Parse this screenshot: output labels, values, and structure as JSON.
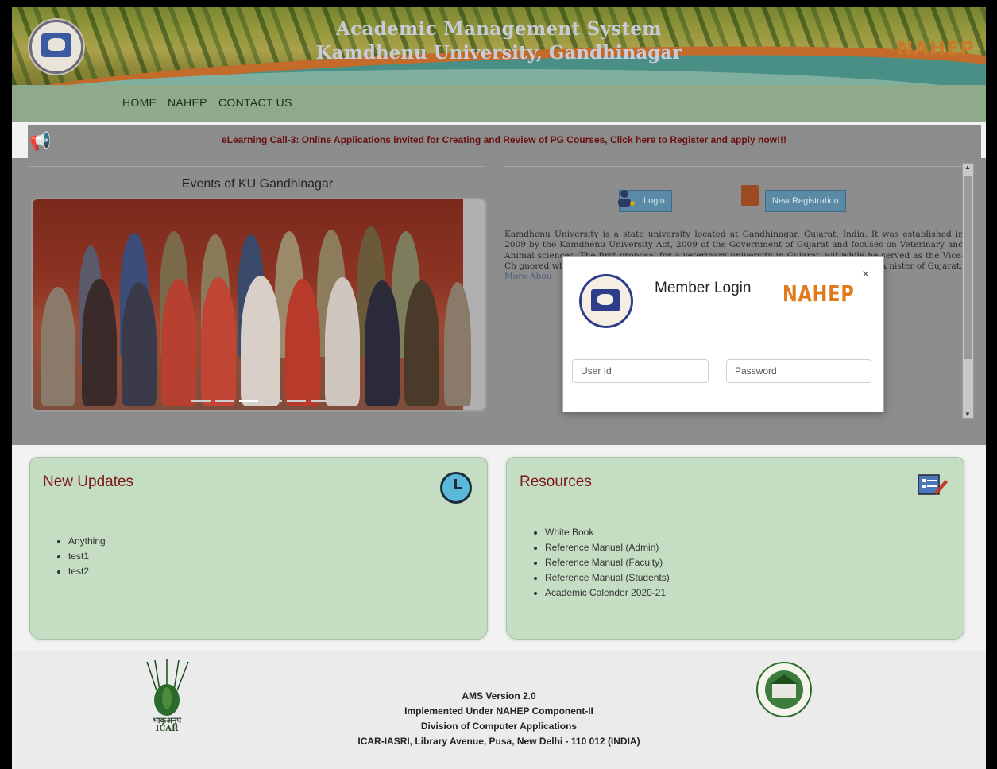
{
  "header": {
    "title_line1": "Academic Management System",
    "title_line2": "Kamdhenu University, Gandhinagar",
    "right_logo_text": "NAHEP"
  },
  "nav": {
    "items": [
      {
        "label": "HOME"
      },
      {
        "label": "NAHEP"
      },
      {
        "label": "CONTACT US"
      }
    ]
  },
  "notice": {
    "icon": "megaphone-icon",
    "text": "eLearning Call-3: Online Applications invited for Creating and Review of PG Courses, Click here to Register and apply now!!!"
  },
  "events": {
    "title": "Events of KU Gandhinagar"
  },
  "actions": {
    "login_label": "Login",
    "register_label": "New Registration"
  },
  "about": {
    "text": "Kamdhenu University is a state university located at Gandhinagar, Gujarat, India. It was established in 2009 by the Kamdhenu University Act, 2009 of the Government of Gujarat and focuses on Veterinary and Animal sciences. The first proposal for a veterinary university in Gujarat, wit while he served as the Vice-Ch gnored when he resigned fr ent of Gujarat in 1996–97, bu the Kamdhenu University A nister of Gujarat.",
    "more_label": "More Abou"
  },
  "modal": {
    "title": "Member Login",
    "logo_text": "NAHEP",
    "close_label": "×",
    "userid_placeholder": "User Id",
    "password_placeholder": "Password"
  },
  "updates": {
    "title": "New Updates",
    "items": [
      "Anything",
      "test1",
      "test2"
    ]
  },
  "resources": {
    "title": "Resources",
    "items": [
      "White Book",
      "Reference Manual (Admin)",
      "Reference Manual (Faculty)",
      "Reference Manual (Students)",
      "Academic Calender 2020-21"
    ]
  },
  "footer": {
    "line1": "AMS Version 2.0",
    "line2": "Implemented Under NAHEP Component-II",
    "line3": "Division of Computer Applications",
    "line4": "ICAR-IASRI, Library Avenue, Pusa, New Delhi - 110 012 (INDIA)",
    "icar_label_hindi": "भाकृअनुप",
    "icar_label": "ICAR"
  }
}
